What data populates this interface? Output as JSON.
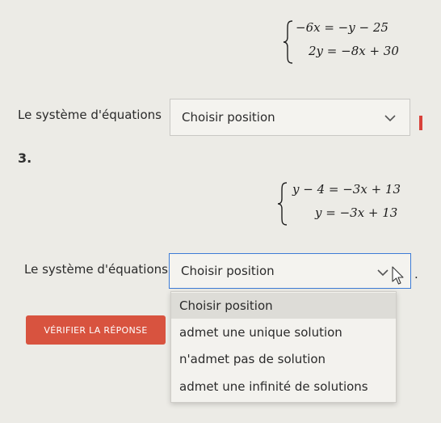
{
  "system1": {
    "eq1": "−6x = −y − 25",
    "eq2": "2y = −8x + 30"
  },
  "row1": {
    "label": "Le système d'équations",
    "select_value": "Choisir position",
    "alert_color": "#d8413a"
  },
  "question_number": "3.",
  "system2": {
    "eq1": "y − 4 = −3x + 13",
    "eq2": "y = −3x + 13"
  },
  "row2": {
    "label": "Le système d'équations",
    "select_value": "Choisir position",
    "trailing": "."
  },
  "verify_button": {
    "label": "VÉRIFIER LA RÉPONSE",
    "color": "#d8533f"
  },
  "dropdown": {
    "options": [
      "Choisir position",
      "admet une unique solution",
      "n'admet pas de solution",
      "admet une infinité de solutions"
    ],
    "highlighted_option": "Choisir position"
  },
  "icons": {
    "select_arrow": "chevron-down-icon",
    "cursor": "mouse-pointer-icon"
  }
}
